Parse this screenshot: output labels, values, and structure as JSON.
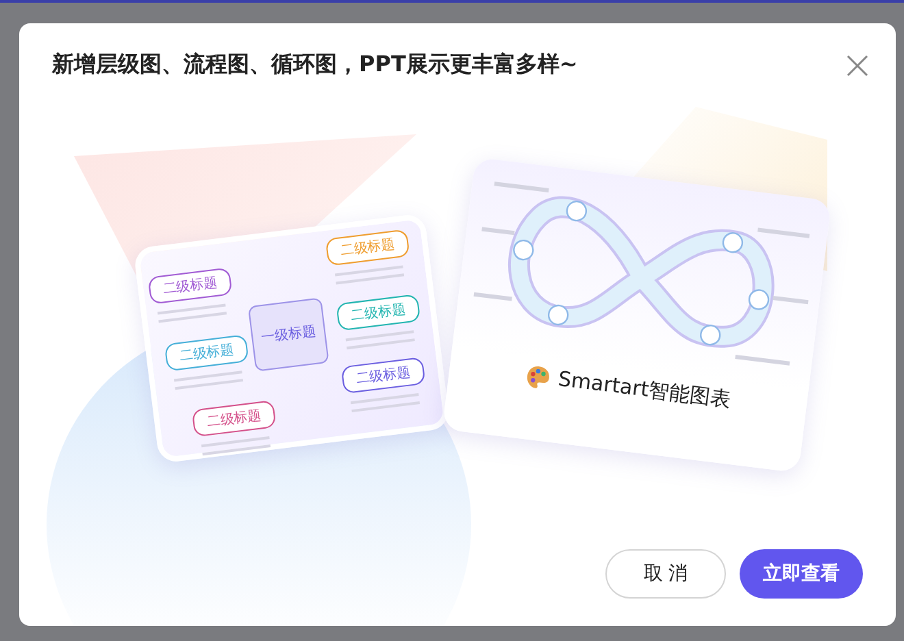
{
  "dialog": {
    "title": "新增层级图、流程图、循环图，PPT展示更丰富多样~"
  },
  "illustration": {
    "mindmap": {
      "root": "一级标题",
      "branches": [
        {
          "title": "二级标题",
          "color": "#a15bd4"
        },
        {
          "title": "二级标题",
          "color": "#45afd8"
        },
        {
          "title": "二级标题",
          "color": "#d4508a"
        },
        {
          "title": "二级标题",
          "color": "#ef9d2e"
        },
        {
          "title": "二级标题",
          "color": "#22b5b0"
        },
        {
          "title": "二级标题",
          "color": "#6a5ee0"
        }
      ]
    },
    "caption": "Smartart智能图表"
  },
  "buttons": [
    {
      "label": "取 消",
      "kind": "secondary"
    },
    {
      "label": "立即查看",
      "kind": "primary"
    }
  ]
}
